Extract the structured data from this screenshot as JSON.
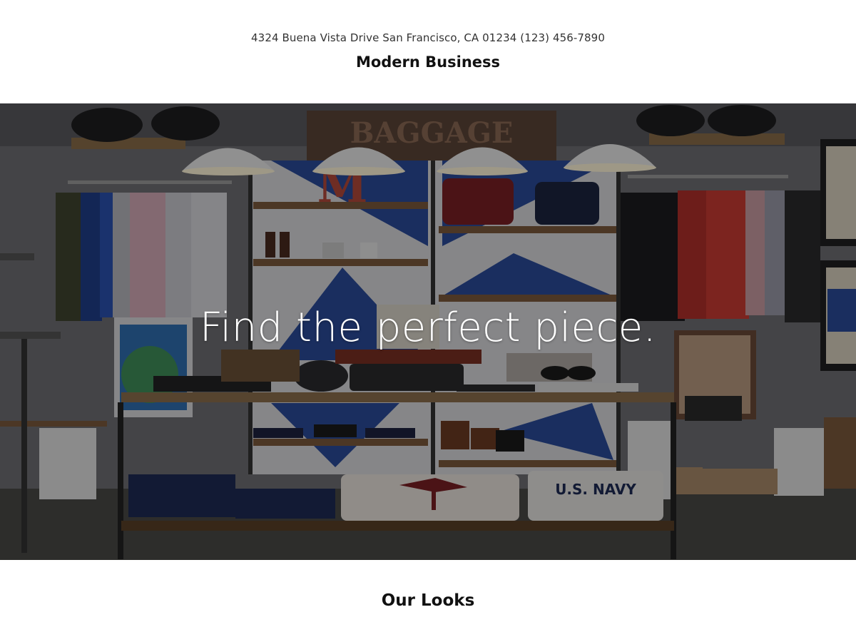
{
  "header": {
    "address": "4324 Buena Vista Drive San Francisco, CA 01234 (123) 456-7890",
    "brand": "Modern Business"
  },
  "hero": {
    "tagline": "Find the perfect piece.",
    "image": "clothing-store-interior-photo",
    "sign_text": "BAGGAGE",
    "shelf_letter": "M",
    "sweater_text": "U.S. NAVY"
  },
  "sections": {
    "looks_title": "Our Looks"
  },
  "colors": {
    "text": "#111111",
    "overlay_text": "#ffffff",
    "background": "#ffffff"
  }
}
